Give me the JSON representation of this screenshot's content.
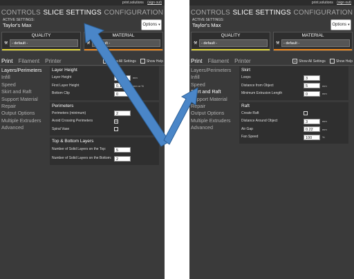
{
  "left": {
    "topbar": {
      "site": "print.solutions",
      "signout": "(sign out)"
    },
    "tabs": [
      "CONTROLS",
      "SLICE SETTINGS",
      "CONFIGURATION"
    ],
    "active_label": "ACTIVE SETTINGS:",
    "active_name": "Taylor's Max",
    "options": "Options",
    "quality": {
      "title": "QUALITY",
      "value": "- default -"
    },
    "material": {
      "title": "MATERIAL",
      "value": "- default -"
    },
    "subtabs": [
      "Print",
      "Filament",
      "Printer"
    ],
    "show_all": "Show All Settings",
    "show_help": "Show Help",
    "categories": [
      "Layers/Perimeters",
      "Infill",
      "Speed",
      "Skirt and Raft",
      "Support Material",
      "Repair",
      "Output Options",
      "Multiple Extruders",
      "Advanced"
    ],
    "groups": [
      {
        "title": "Layer Height",
        "rows": [
          {
            "label": "Layer Height",
            "value": "0.3",
            "unit": "mm"
          },
          {
            "label": "First Layer Height",
            "value": "0.15",
            "unit": "mm or %"
          },
          {
            "label": "Bottom Clip",
            "value": "0",
            "unit": ""
          }
        ]
      },
      {
        "title": "Perimeters",
        "rows": [
          {
            "label": "Perimeters (minimum)",
            "value": "2",
            "unit": ""
          },
          {
            "label": "Avoid Crossing Perimeters",
            "value": "",
            "unit": "",
            "checkbox": "☒"
          },
          {
            "label": "Spiral Vase",
            "value": "",
            "unit": "",
            "checkbox": ""
          }
        ]
      },
      {
        "title": "Top & Bottom Layers",
        "rows": [
          {
            "label": "Number of Solid Layers on the Top:",
            "value": "5",
            "unit": ""
          },
          {
            "label": "Number of Solid Layers on the Bottom:",
            "value": "2",
            "unit": ""
          }
        ]
      }
    ]
  },
  "right": {
    "topbar": {
      "site": "print.solutions",
      "signout": "(sign out)"
    },
    "tabs": [
      "CONTROLS",
      "SLICE SETTINGS",
      "CONFIGURATION"
    ],
    "active_label": "ACTIVE SETTINGS:",
    "active_name": "Taylor's Max",
    "options": "Options",
    "quality": {
      "title": "QUALITY",
      "value": "- default -"
    },
    "material": {
      "title": "MATERIAL",
      "value": "- default -"
    },
    "subtabs": [
      "Print",
      "Filament",
      "Printer"
    ],
    "show_all": "Show All Settings",
    "show_help": "Show Help",
    "categories": [
      "Layers/Perimeters",
      "Infill",
      "Speed",
      "Skirt and Raft",
      "Support Material",
      "Repair",
      "Output Options",
      "Multiple Extruders",
      "Advanced"
    ],
    "groups": [
      {
        "title": "Skirt",
        "rows": [
          {
            "label": "Loops",
            "value": "3",
            "unit": ""
          },
          {
            "label": "Distance from Object",
            "value": "5",
            "unit": "mm"
          },
          {
            "label": "Minimum Extrusion Length",
            "value": "0",
            "unit": "mm"
          }
        ]
      },
      {
        "title": "Raft",
        "rows": [
          {
            "label": "Create Raft",
            "value": "",
            "unit": "",
            "checkbox": ""
          },
          {
            "label": "Distance Around Object",
            "value": "3",
            "unit": "mm"
          },
          {
            "label": "Air Gap",
            "value": "0.22",
            "unit": "mm"
          },
          {
            "label": "Fan Speed",
            "value": "100",
            "unit": "%"
          }
        ]
      }
    ]
  },
  "colors": {
    "quality_bar": "#e3d63a",
    "material_bar": "#f08a1d",
    "arrow": "#4a86c8"
  }
}
